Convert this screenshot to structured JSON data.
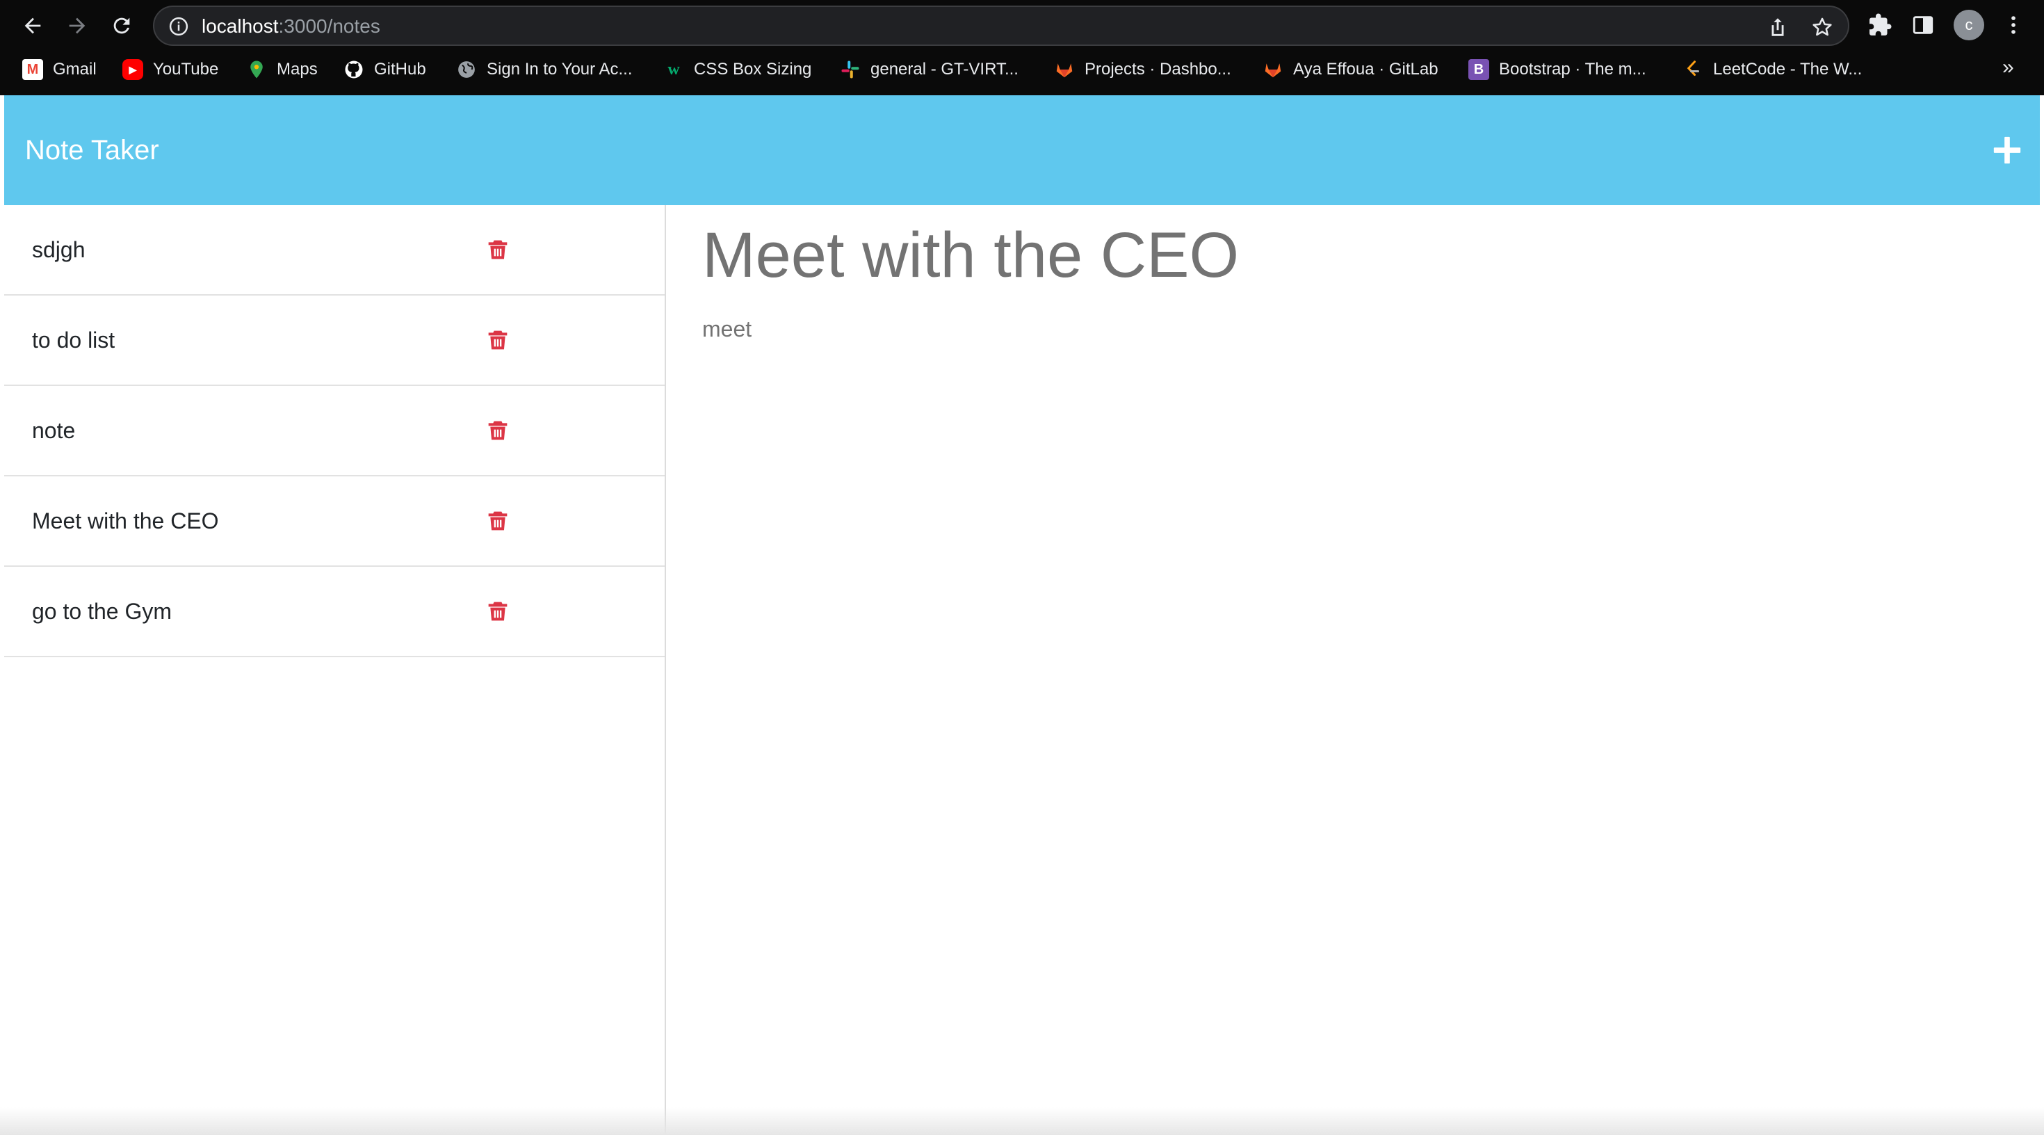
{
  "browser": {
    "url_host": "localhost",
    "url_path": ":3000/notes",
    "profile_initial": "c",
    "bookmarks": [
      {
        "label": "Gmail",
        "icon": "gmail-icon",
        "color": "#ea4335"
      },
      {
        "label": "YouTube",
        "icon": "youtube-icon",
        "color": "#ff0000"
      },
      {
        "label": "Maps",
        "icon": "maps-icon",
        "color": "#34a853"
      },
      {
        "label": "GitHub",
        "icon": "github-icon",
        "color": "#ffffff"
      },
      {
        "label": "Sign In to Your Ac...",
        "icon": "globe-icon",
        "color": "#9aa0a6"
      },
      {
        "label": "CSS Box Sizing",
        "icon": "w3schools-icon",
        "color": "#04aa6d"
      },
      {
        "label": "general - GT-VIRT...",
        "icon": "slack-icon",
        "color": "#e01e5a"
      },
      {
        "label": "Projects · Dashbo...",
        "icon": "gitlab-icon",
        "color": "#fc6d26"
      },
      {
        "label": "Aya Effoua · GitLab",
        "icon": "gitlab-icon",
        "color": "#fc6d26"
      },
      {
        "label": "Bootstrap · The m...",
        "icon": "bootstrap-icon",
        "color": "#7952b3"
      },
      {
        "label": "LeetCode - The W...",
        "icon": "leetcode-icon",
        "color": "#ffa116"
      }
    ],
    "more_label": "»"
  },
  "app": {
    "brand": "Note Taker",
    "accent_color": "#5fc8ee",
    "delete_color": "#dc3545",
    "notes": [
      {
        "title": "sdjgh"
      },
      {
        "title": "to do list"
      },
      {
        "title": "note"
      },
      {
        "title": "Meet with the CEO"
      },
      {
        "title": "go to the Gym"
      }
    ],
    "active_note": {
      "title": "Meet with the CEO",
      "text": "meet"
    }
  }
}
